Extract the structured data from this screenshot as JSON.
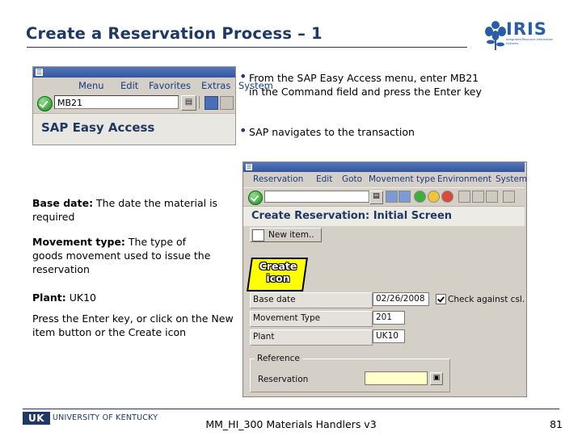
{
  "slide": {
    "title": "Create a Reservation Process – 1",
    "page_number": "81",
    "footer_title": "MM_HI_300 Materials Handlers v3"
  },
  "logo": {
    "iris_text": "IRIS",
    "iris_sub": "Integrated Resource Information Systems"
  },
  "uk_logo": {
    "mark": "UK",
    "name": "UNIVERSITY  OF  KENTUCKY"
  },
  "sap_easy_access": {
    "menu": [
      "Menu",
      "Edit",
      "Favorites",
      "Extras",
      "System"
    ],
    "command_value": "MB21",
    "screen_title": "SAP Easy Access"
  },
  "bullets": [
    {
      "marker": "•",
      "text": "From the SAP Easy Access menu, enter MB21 in the Command field and press the Enter key"
    },
    {
      "marker": "•",
      "text": "SAP navigates to the transaction"
    }
  ],
  "body": {
    "base_date_label": "Base date:",
    "base_date_text": " The date the material is required",
    "movement_type_label": "Movement type:",
    "movement_type_text": " The type of goods movement used to issue the reservation",
    "plant_label": "Plant:",
    "plant_text": " UK10",
    "press_text": "Press the Enter key, or click on the New item button or the Create icon"
  },
  "reservation_window": {
    "menu": [
      "Reservation",
      "Edit",
      "Goto",
      "Movement type",
      "Environment",
      "System"
    ],
    "command_value": "",
    "screen_title": "Create Reservation: Initial Screen",
    "new_item_button": "New item..",
    "fields": [
      {
        "label": "Base date",
        "value": "02/26/2008"
      },
      {
        "label": "Movement Type",
        "value": "201"
      },
      {
        "label": "Plant",
        "value": "UK10"
      }
    ],
    "checkbox_label": "Check against csl.",
    "group_label": "Reference",
    "reference_field_label": "Reservation",
    "reference_field_value": ""
  },
  "callout": {
    "line1": "Create",
    "line2": "icon"
  }
}
